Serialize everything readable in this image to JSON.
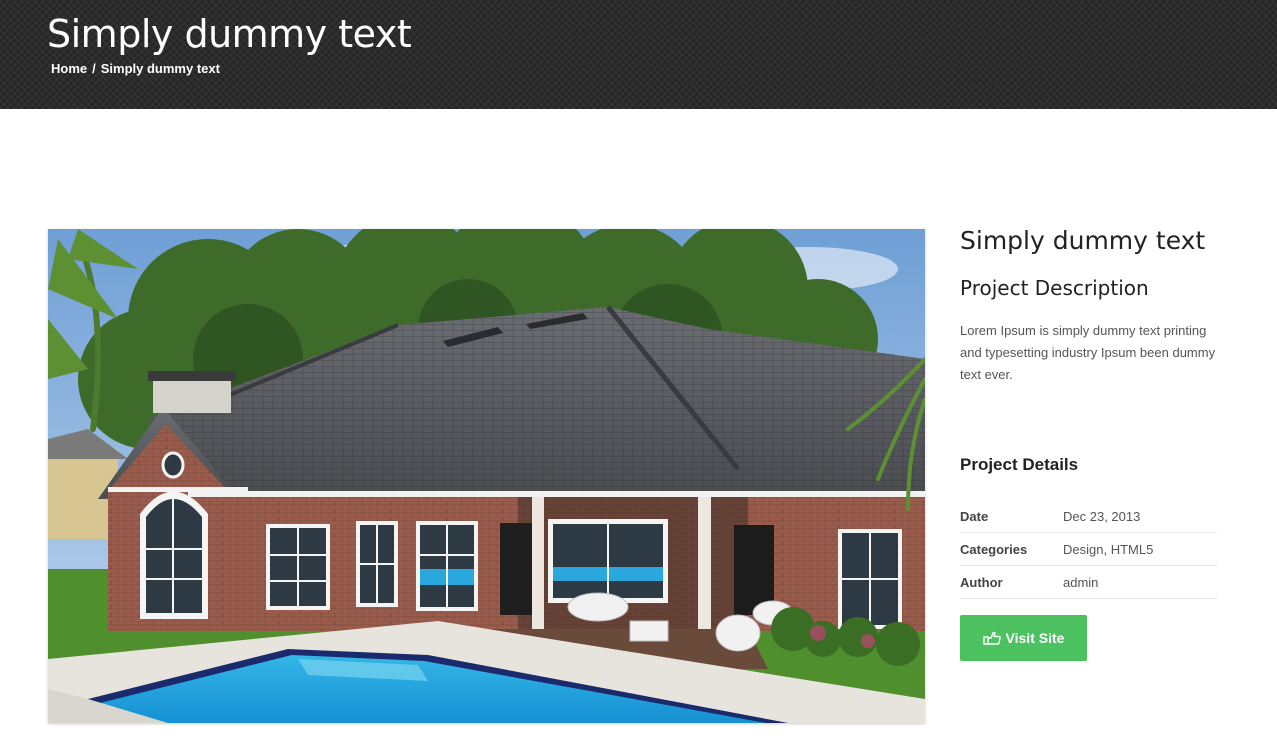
{
  "header": {
    "title": "Simply dummy text",
    "breadcrumb": {
      "home": "Home",
      "separator": "/",
      "current": "Simply dummy text"
    }
  },
  "project": {
    "image_icon": "house-with-pool-photo",
    "title": "Simply dummy text",
    "description_heading": "Project Description",
    "description": "Lorem Ipsum is simply dummy text printing and typesetting industry Ipsum been dummy text ever.",
    "details_heading": "Project Details",
    "details": [
      {
        "label": "Date",
        "value": "Dec 23, 2013"
      },
      {
        "label": "Categories",
        "value": "Design, HTML5"
      },
      {
        "label": "Author",
        "value": "admin"
      }
    ],
    "visit_button": {
      "label": "Visit Site",
      "icon": "hand-pointer-icon",
      "color": "#4cc160"
    }
  },
  "colors": {
    "header_bg": "#2c2c2c",
    "accent": "#4cc160"
  }
}
